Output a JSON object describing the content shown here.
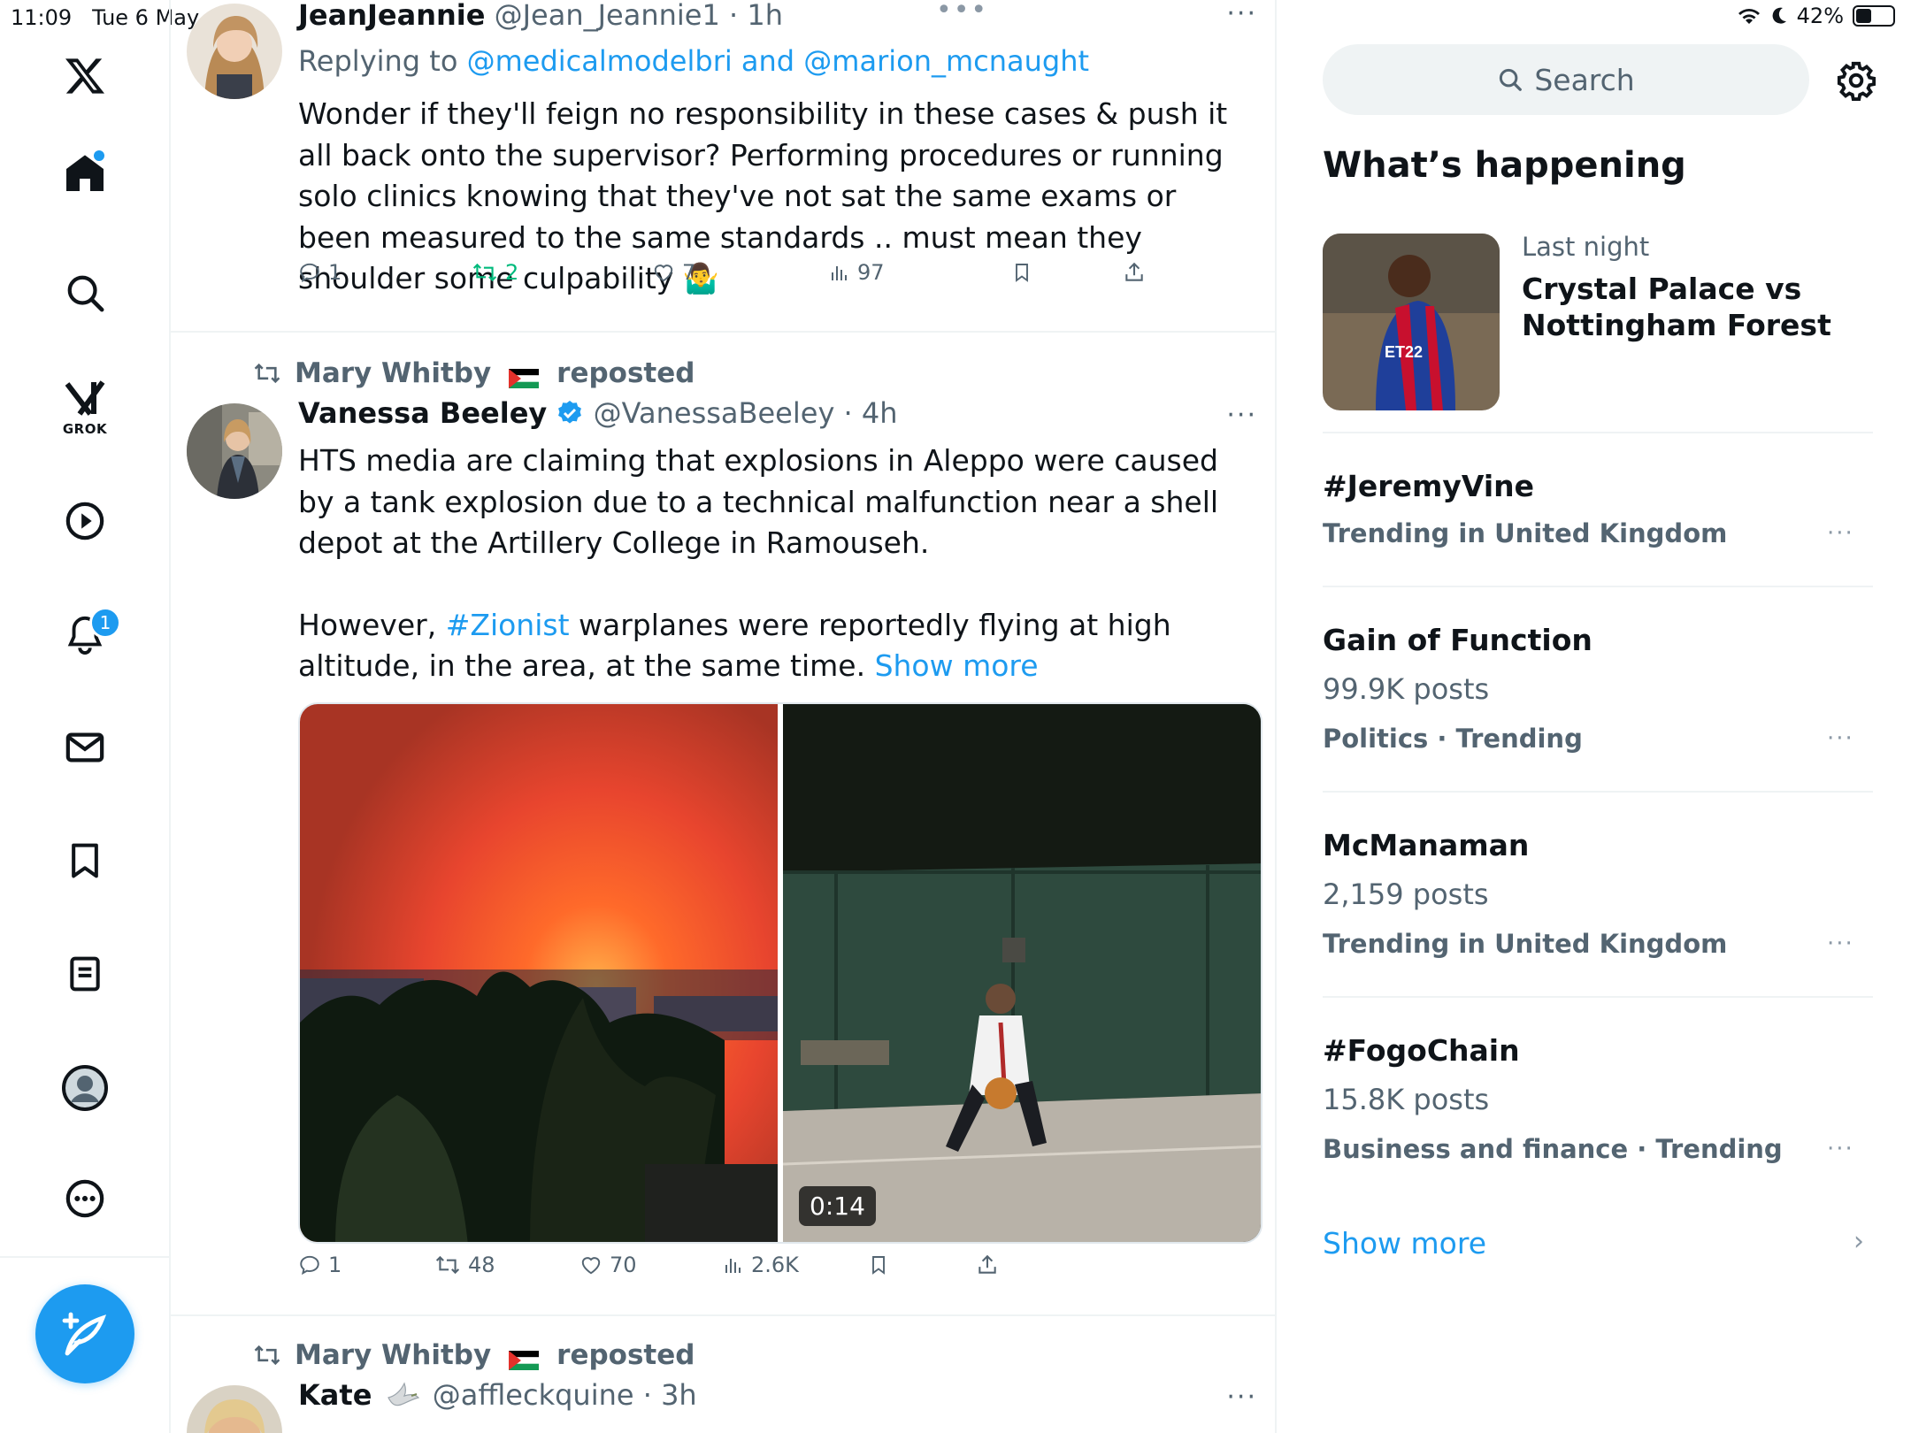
{
  "status_bar": {
    "time": "11:09",
    "date": "Tue 6 May",
    "battery": "42%",
    "battery_level": 0.42
  },
  "nav": {
    "grok_label": "GROK",
    "notifications_badge": "1"
  },
  "tweets": [
    {
      "name": "JeanJeannie",
      "handle": "@Jean_Jeannie1",
      "time": "1h",
      "reply_prefix": "Replying to",
      "reply_to": "@medicalmodelbri and @marion_mcnaught",
      "text": "Wonder if they'll feign no responsibility in these cases & push it all back onto the supervisor? Performing procedures or running solo clinics knowing that they've not sat the same exams or been measured to the same standards .. must mean they shoulder some culpability 🤷‍♂️",
      "replies": "1",
      "reposts": "2",
      "likes": "7",
      "views": "97"
    },
    {
      "reposted_by": "Mary Whitby",
      "reposted_label": "reposted",
      "name": "Vanessa Beeley",
      "handle": "@VanessaBeeley",
      "time": "4h",
      "text_p1": "HTS media are claiming that explosions in Aleppo were caused by a tank explosion due to a technical malfunction near a shell depot at the Artillery College in Ramouseh.",
      "text_p2_before": "However, ",
      "hashtag": "#Zionist",
      "text_p2_after": " warplanes were reportedly flying at high altitude, in the area,  at the same time. ",
      "show_more": "Show more",
      "video_duration": "0:14",
      "replies": "1",
      "reposts": "48",
      "likes": "70",
      "views": "2.6K"
    },
    {
      "reposted_by": "Mary Whitby",
      "reposted_label": "reposted",
      "name": "Kate",
      "handle": "@affleckquine",
      "time": "3h"
    }
  ],
  "right": {
    "search_placeholder": "Search",
    "whats_happening": "What’s happening",
    "lead": {
      "meta": "Last night",
      "title": "Crystal Palace vs Nottingham Forest"
    },
    "trends": [
      {
        "title": "#JeremyVine",
        "posts": "",
        "meta": "Trending in United Kingdom"
      },
      {
        "title": "Gain of Function",
        "posts": "99.9K posts",
        "meta": "Politics · Trending"
      },
      {
        "title": "McManaman",
        "posts": "2,159 posts",
        "meta": "Trending in United Kingdom"
      },
      {
        "title": "#FogoChain",
        "posts": "15.8K posts",
        "meta": "Business and finance · Trending"
      }
    ],
    "show_more": "Show more"
  },
  "colors": {
    "accent": "#1d9bf0",
    "repost_green": "#00ba7c",
    "muted": "#536471"
  },
  "icons": [
    "x-logo-icon",
    "home-icon",
    "search-icon",
    "grok-icon",
    "video-icon",
    "bell-icon",
    "mail-icon",
    "bookmark-icon",
    "list-icon",
    "profile-icon",
    "more-icon",
    "compose-icon",
    "reply-icon",
    "repost-icon",
    "like-icon",
    "views-icon",
    "share-icon",
    "gear-icon",
    "chevron-right-icon"
  ]
}
